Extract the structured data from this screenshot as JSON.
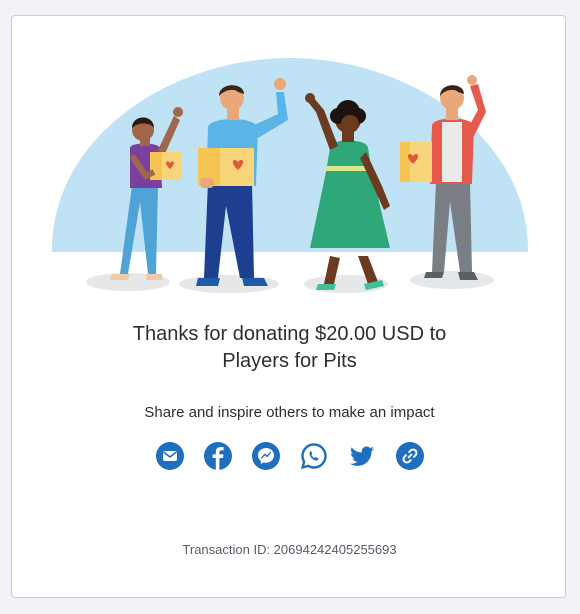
{
  "thanks": {
    "line1": "Thanks for donating $20.00 USD to",
    "line2": "Players for Pits"
  },
  "share": {
    "prompt": "Share and inspire others to make an impact",
    "buttons": [
      {
        "icon": "email-icon"
      },
      {
        "icon": "facebook-icon"
      },
      {
        "icon": "messenger-icon"
      },
      {
        "icon": "whatsapp-icon"
      },
      {
        "icon": "twitter-icon"
      },
      {
        "icon": "link-icon"
      }
    ],
    "icon_color": "#1f6fbe"
  },
  "transaction": {
    "text": "Transaction ID: 20694242405255693"
  },
  "colors": {
    "page_bg": "#f2f3f7",
    "card_bg": "#ffffff",
    "arch": "#bfe3f5"
  }
}
